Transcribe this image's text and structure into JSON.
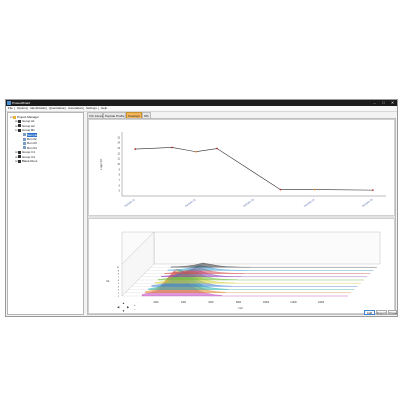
{
  "window": {
    "title": "ProteoWizard",
    "controls": {
      "minimize": "–",
      "maximize": "□",
      "close": "✕"
    }
  },
  "menu": [
    "File",
    "Options",
    "Identification",
    "Quantitation",
    "Annotations",
    "Settings",
    "Help"
  ],
  "tree": {
    "items": [
      {
        "label": "Project Manager",
        "depth": 0,
        "expander": "⊟",
        "icon_color": "#e5b437",
        "selected": false
      },
      {
        "label": "Group A1",
        "depth": 1,
        "expander": "⊞",
        "icon_color": "#2f2f2f",
        "selected": false
      },
      {
        "label": "Group A2",
        "depth": 1,
        "expander": "⊞",
        "icon_color": "#2f2f2f",
        "selected": false
      },
      {
        "label": "Group B1",
        "depth": 1,
        "expander": "⊟",
        "icon_color": "#2f2f2f",
        "selected": false
      },
      {
        "label": "Sample",
        "depth": 2,
        "expander": "",
        "icon_color": "#7a9cc4",
        "selected": true
      },
      {
        "label": "Run 02",
        "depth": 2,
        "expander": "",
        "icon_color": "#7a9cc4",
        "selected": false
      },
      {
        "label": "Run 03",
        "depth": 2,
        "expander": "",
        "icon_color": "#7a9cc4",
        "selected": false
      },
      {
        "label": "Run 04",
        "depth": 2,
        "expander": "",
        "icon_color": "#7a9cc4",
        "selected": false
      },
      {
        "label": "Group C1",
        "depth": 1,
        "expander": "⊞",
        "icon_color": "#2f2f2f",
        "selected": false
      },
      {
        "label": "Group C2",
        "depth": 1,
        "expander": "⊞",
        "icon_color": "#2f2f2f",
        "selected": false
      },
      {
        "label": "Blank Runs",
        "depth": 1,
        "expander": "⊞",
        "icon_color": "#2f2f2f",
        "selected": false
      }
    ]
  },
  "tabs": [
    {
      "label": "XIC traces",
      "active": false
    },
    {
      "label": "Peptide Profile",
      "active": false
    },
    {
      "label": "Overlays",
      "active": true
    },
    {
      "label": "MS",
      "active": false
    }
  ],
  "top_chart": {
    "ylabel": "Log2 Int."
  },
  "bottom_chart": {
    "ylabel": "Int.",
    "xlabel": "m/z"
  },
  "zoom_controls": [
    "▲",
    "◀",
    "▶",
    "▼",
    "+",
    "−"
  ],
  "buttons": {
    "add": "Add",
    "export": "Export",
    "close": "Close"
  },
  "colors": {
    "accent": "#f2b55a",
    "selection": "#2a6ec9",
    "line": "#2b2b2b",
    "marker": "#b5352a",
    "marker_alt": "#e38a2c"
  },
  "chart_data": [
    {
      "type": "line",
      "categories": [
        "Sample 01",
        "Sample 02",
        "Sample 03",
        "Sample 04",
        "Sample 05"
      ],
      "x": [
        1,
        3.3,
        5.5,
        7.8,
        10
      ],
      "values": [
        12.8,
        12.9,
        12.3,
        5.2,
        5.1
      ],
      "points": [
        {
          "x": 1,
          "y": 12.8
        },
        {
          "x": 2.4,
          "y": 13.1
        },
        {
          "x": 3.3,
          "y": 12.3
        },
        {
          "x": 4.1,
          "y": 12.9
        },
        {
          "x": 6.5,
          "y": 5.2
        },
        {
          "x": 7.8,
          "y": 5.2
        },
        {
          "x": 10,
          "y": 5.1
        }
      ],
      "ylim": [
        4,
        16
      ],
      "yticks": [
        5,
        6,
        7,
        8,
        9,
        10,
        11,
        12,
        13,
        14,
        15
      ],
      "ylabel": "Log2 Int.",
      "xlabel": "",
      "grid": false,
      "legend": "none"
    },
    {
      "type": "area",
      "style": "waterfall-3d",
      "x": [
        100,
        200,
        300,
        400,
        500,
        600,
        700,
        800,
        900,
        1000,
        1100
      ],
      "xticks": [
        "2000",
        "4000",
        "6000",
        "8000",
        "10000",
        "12000",
        "14000"
      ],
      "yticks": [
        "1",
        "2",
        "3",
        "4",
        "5",
        "6",
        "7",
        "8",
        "9",
        "10"
      ],
      "xlabel": "m/z",
      "ylabel": "Int.",
      "series": [
        {
          "values": [
            0.05,
            0.12,
            0.2,
            0.55,
            0.9,
            0.7,
            0.4,
            0.2,
            0.1,
            0.05,
            0.02
          ],
          "color": "#c23fbf"
        },
        {
          "values": [
            0.04,
            0.1,
            0.25,
            0.6,
            0.85,
            0.75,
            0.35,
            0.18,
            0.08,
            0.04,
            0.02
          ],
          "color": "#e38a2c"
        },
        {
          "values": [
            0.03,
            0.08,
            0.18,
            0.42,
            0.7,
            0.52,
            0.28,
            0.12,
            0.06,
            0.03,
            0.01
          ],
          "color": "#2cb7b0"
        },
        {
          "values": [
            0.03,
            0.07,
            0.15,
            0.35,
            0.55,
            0.45,
            0.2,
            0.1,
            0.05,
            0.02,
            0.01
          ],
          "color": "#3c7fd6"
        },
        {
          "values": [
            0.02,
            0.06,
            0.12,
            0.28,
            0.45,
            0.35,
            0.16,
            0.08,
            0.04,
            0.02,
            0.01
          ],
          "color": "#d9d12c"
        },
        {
          "values": [
            0.02,
            0.05,
            0.1,
            0.22,
            0.35,
            0.27,
            0.12,
            0.06,
            0.03,
            0.02,
            0.01
          ],
          "color": "#6bbf3a"
        },
        {
          "values": [
            0.02,
            0.04,
            0.08,
            0.17,
            0.28,
            0.2,
            0.1,
            0.05,
            0.02,
            0.01,
            0.01
          ],
          "color": "#8a3fb8"
        },
        {
          "values": [
            0.01,
            0.03,
            0.06,
            0.13,
            0.22,
            0.16,
            0.08,
            0.04,
            0.02,
            0.01,
            0.0
          ],
          "color": "#d94a4a"
        },
        {
          "values": [
            0.01,
            0.03,
            0.05,
            0.1,
            0.18,
            0.12,
            0.06,
            0.03,
            0.01,
            0.01,
            0.0
          ],
          "color": "#3aa1d9"
        },
        {
          "values": [
            0.01,
            0.02,
            0.04,
            0.08,
            0.15,
            0.1,
            0.05,
            0.02,
            0.01,
            0.0,
            0.0
          ],
          "color": "#333333"
        }
      ],
      "legend": "none"
    }
  ]
}
